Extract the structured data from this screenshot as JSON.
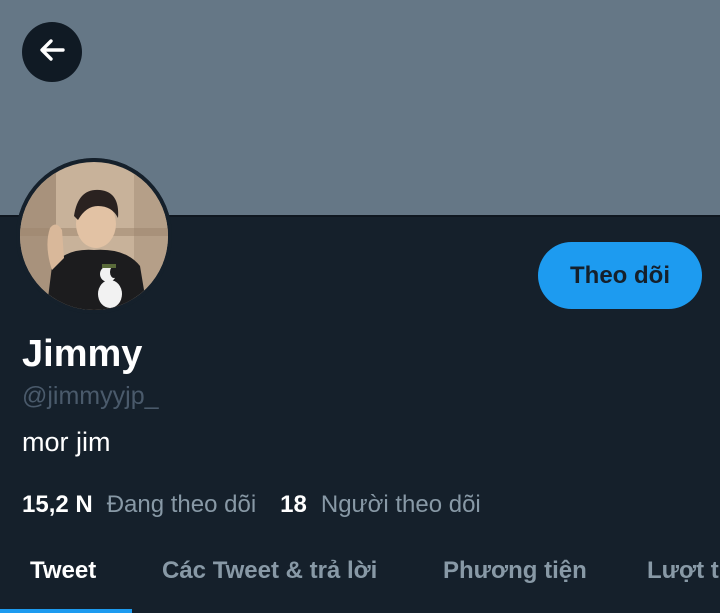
{
  "header": {
    "back_icon": "arrow-left-icon"
  },
  "profile": {
    "display_name": "Jimmy",
    "handle": "@jimmyyjp_",
    "bio": "mor jim",
    "follow_label": "Theo dõi"
  },
  "stats": {
    "following_count": "15,2 N",
    "following_label": "Đang theo dõi",
    "followers_count": "18",
    "followers_label": "Người theo dõi"
  },
  "tabs": [
    {
      "label": "Tweet",
      "active": true
    },
    {
      "label": "Các Tweet & trả lời",
      "active": false
    },
    {
      "label": "Phương tiện",
      "active": false
    },
    {
      "label": "Lượt thích",
      "active": false
    }
  ],
  "colors": {
    "background": "#15202b",
    "banner": "#657786",
    "accent": "#1d9bf0",
    "secondary_text": "#8899a6"
  }
}
